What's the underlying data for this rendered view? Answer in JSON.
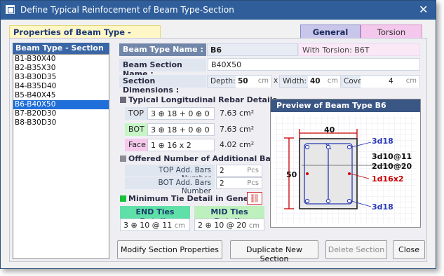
{
  "window": {
    "title": "Define Typical Reinfocement of Beam Type-Section"
  },
  "props_title": "Properties of Beam Type - Section",
  "tabs": [
    {
      "label": "General"
    },
    {
      "label": "Torsion"
    }
  ],
  "list": {
    "header": "Beam Type - Section",
    "items": [
      "B1-B30X40",
      "B2-B35X30",
      "B3-B30D35",
      "B4-B35D40",
      "B5-B40X45",
      "B6-B40X50",
      "B7-B20D30",
      "B8-B30D30"
    ],
    "selected": "B6-B40X50"
  },
  "beam": {
    "type_label": "Beam Type Name :",
    "type_value": "B6",
    "torsion_text": "With Torsion: B6T",
    "section_label": "Beam Section Name :",
    "section_value": "B40X50",
    "dim_label": "Section Dimensions :",
    "depth_label": "Depth:",
    "depth_value": "50",
    "depth_unit": "cm",
    "x_sep": "x",
    "width_label": "Width:",
    "width_value": "40",
    "width_unit": "cm",
    "cover_label": "Cover:",
    "cover_value": "4",
    "cover_unit": "cm"
  },
  "longitudinal": {
    "title": "Typical Longitudinal Rebar Details",
    "top_label": "TOP",
    "top_value": "3 ⊕ 18  +  0 ⊕ 0",
    "top_area": "7.63 cm²",
    "bot_label": "BOT",
    "bot_value": "3 ⊕ 18  +  0 ⊕ 0",
    "bot_area": "7.63 cm²",
    "face_label": "Face",
    "face_value": "1 ⊕ 16  x  2",
    "face_area": "4.02 cm²"
  },
  "additional": {
    "title": "Offered Number of Additional Bars",
    "top_label": "TOP Add. Bars Number",
    "top_value": "2",
    "bot_label": "BOT Add. Bars Number",
    "bot_value": "2",
    "unit": "Pcs"
  },
  "ties": {
    "title": "Minimum Tie Detail in General",
    "end_label": "END Ties Details",
    "end_value": "3  ⊕  10 @ 11",
    "mid_label": "MID Ties Details",
    "mid_value": "2  ⊕  10 @ 20",
    "unit": "cm"
  },
  "preview": {
    "title": "Preview of Beam Type B6",
    "width_dim": "40",
    "depth_dim": "50",
    "top_bar": "3d18",
    "tie1": "3d10@11",
    "tie2": "2d10@20",
    "face_bar": "1d16x2",
    "bot_bar": "3d18"
  },
  "buttons": {
    "modify": "Modify Section Properties",
    "duplicate": "Duplicate New Section",
    "delete": "Delete Section",
    "close": "Close"
  },
  "colors": {
    "title_bar": "#2f5e9b",
    "selected_row": "#1e6fd9",
    "top_green": "#c6f5c6",
    "face_pink": "#f6c9ec",
    "end_ties": "#5fe0a8",
    "mid_ties": "#bdf0bd",
    "dim_red": "#cc0000",
    "bar_blue": "#2a3ab5"
  }
}
